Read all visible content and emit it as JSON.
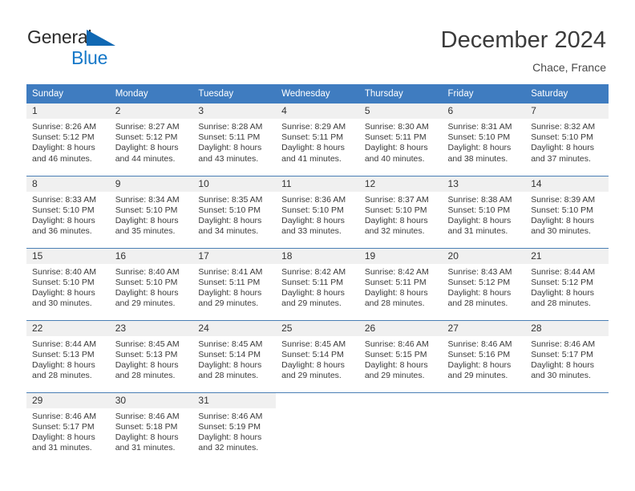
{
  "brand": {
    "name_primary": "General",
    "name_secondary": "Blue",
    "triangle_color": "#1068b3"
  },
  "header": {
    "title": "December 2024",
    "subtitle": "Chace, France",
    "accent_color": "#3f7cc0"
  },
  "weekday_headers": [
    "Sunday",
    "Monday",
    "Tuesday",
    "Wednesday",
    "Thursday",
    "Friday",
    "Saturday"
  ],
  "labels": {
    "sunrise_prefix": "Sunrise:",
    "sunset_prefix": "Sunset:",
    "daylight_prefix": "Daylight:"
  },
  "weeks": [
    [
      {
        "day": "1",
        "sunrise": "Sunrise: 8:26 AM",
        "sunset": "Sunset: 5:12 PM",
        "daylight_line1": "Daylight: 8 hours",
        "daylight_line2": "and 46 minutes."
      },
      {
        "day": "2",
        "sunrise": "Sunrise: 8:27 AM",
        "sunset": "Sunset: 5:12 PM",
        "daylight_line1": "Daylight: 8 hours",
        "daylight_line2": "and 44 minutes."
      },
      {
        "day": "3",
        "sunrise": "Sunrise: 8:28 AM",
        "sunset": "Sunset: 5:11 PM",
        "daylight_line1": "Daylight: 8 hours",
        "daylight_line2": "and 43 minutes."
      },
      {
        "day": "4",
        "sunrise": "Sunrise: 8:29 AM",
        "sunset": "Sunset: 5:11 PM",
        "daylight_line1": "Daylight: 8 hours",
        "daylight_line2": "and 41 minutes."
      },
      {
        "day": "5",
        "sunrise": "Sunrise: 8:30 AM",
        "sunset": "Sunset: 5:11 PM",
        "daylight_line1": "Daylight: 8 hours",
        "daylight_line2": "and 40 minutes."
      },
      {
        "day": "6",
        "sunrise": "Sunrise: 8:31 AM",
        "sunset": "Sunset: 5:10 PM",
        "daylight_line1": "Daylight: 8 hours",
        "daylight_line2": "and 38 minutes."
      },
      {
        "day": "7",
        "sunrise": "Sunrise: 8:32 AM",
        "sunset": "Sunset: 5:10 PM",
        "daylight_line1": "Daylight: 8 hours",
        "daylight_line2": "and 37 minutes."
      }
    ],
    [
      {
        "day": "8",
        "sunrise": "Sunrise: 8:33 AM",
        "sunset": "Sunset: 5:10 PM",
        "daylight_line1": "Daylight: 8 hours",
        "daylight_line2": "and 36 minutes."
      },
      {
        "day": "9",
        "sunrise": "Sunrise: 8:34 AM",
        "sunset": "Sunset: 5:10 PM",
        "daylight_line1": "Daylight: 8 hours",
        "daylight_line2": "and 35 minutes."
      },
      {
        "day": "10",
        "sunrise": "Sunrise: 8:35 AM",
        "sunset": "Sunset: 5:10 PM",
        "daylight_line1": "Daylight: 8 hours",
        "daylight_line2": "and 34 minutes."
      },
      {
        "day": "11",
        "sunrise": "Sunrise: 8:36 AM",
        "sunset": "Sunset: 5:10 PM",
        "daylight_line1": "Daylight: 8 hours",
        "daylight_line2": "and 33 minutes."
      },
      {
        "day": "12",
        "sunrise": "Sunrise: 8:37 AM",
        "sunset": "Sunset: 5:10 PM",
        "daylight_line1": "Daylight: 8 hours",
        "daylight_line2": "and 32 minutes."
      },
      {
        "day": "13",
        "sunrise": "Sunrise: 8:38 AM",
        "sunset": "Sunset: 5:10 PM",
        "daylight_line1": "Daylight: 8 hours",
        "daylight_line2": "and 31 minutes."
      },
      {
        "day": "14",
        "sunrise": "Sunrise: 8:39 AM",
        "sunset": "Sunset: 5:10 PM",
        "daylight_line1": "Daylight: 8 hours",
        "daylight_line2": "and 30 minutes."
      }
    ],
    [
      {
        "day": "15",
        "sunrise": "Sunrise: 8:40 AM",
        "sunset": "Sunset: 5:10 PM",
        "daylight_line1": "Daylight: 8 hours",
        "daylight_line2": "and 30 minutes."
      },
      {
        "day": "16",
        "sunrise": "Sunrise: 8:40 AM",
        "sunset": "Sunset: 5:10 PM",
        "daylight_line1": "Daylight: 8 hours",
        "daylight_line2": "and 29 minutes."
      },
      {
        "day": "17",
        "sunrise": "Sunrise: 8:41 AM",
        "sunset": "Sunset: 5:11 PM",
        "daylight_line1": "Daylight: 8 hours",
        "daylight_line2": "and 29 minutes."
      },
      {
        "day": "18",
        "sunrise": "Sunrise: 8:42 AM",
        "sunset": "Sunset: 5:11 PM",
        "daylight_line1": "Daylight: 8 hours",
        "daylight_line2": "and 29 minutes."
      },
      {
        "day": "19",
        "sunrise": "Sunrise: 8:42 AM",
        "sunset": "Sunset: 5:11 PM",
        "daylight_line1": "Daylight: 8 hours",
        "daylight_line2": "and 28 minutes."
      },
      {
        "day": "20",
        "sunrise": "Sunrise: 8:43 AM",
        "sunset": "Sunset: 5:12 PM",
        "daylight_line1": "Daylight: 8 hours",
        "daylight_line2": "and 28 minutes."
      },
      {
        "day": "21",
        "sunrise": "Sunrise: 8:44 AM",
        "sunset": "Sunset: 5:12 PM",
        "daylight_line1": "Daylight: 8 hours",
        "daylight_line2": "and 28 minutes."
      }
    ],
    [
      {
        "day": "22",
        "sunrise": "Sunrise: 8:44 AM",
        "sunset": "Sunset: 5:13 PM",
        "daylight_line1": "Daylight: 8 hours",
        "daylight_line2": "and 28 minutes."
      },
      {
        "day": "23",
        "sunrise": "Sunrise: 8:45 AM",
        "sunset": "Sunset: 5:13 PM",
        "daylight_line1": "Daylight: 8 hours",
        "daylight_line2": "and 28 minutes."
      },
      {
        "day": "24",
        "sunrise": "Sunrise: 8:45 AM",
        "sunset": "Sunset: 5:14 PM",
        "daylight_line1": "Daylight: 8 hours",
        "daylight_line2": "and 28 minutes."
      },
      {
        "day": "25",
        "sunrise": "Sunrise: 8:45 AM",
        "sunset": "Sunset: 5:14 PM",
        "daylight_line1": "Daylight: 8 hours",
        "daylight_line2": "and 29 minutes."
      },
      {
        "day": "26",
        "sunrise": "Sunrise: 8:46 AM",
        "sunset": "Sunset: 5:15 PM",
        "daylight_line1": "Daylight: 8 hours",
        "daylight_line2": "and 29 minutes."
      },
      {
        "day": "27",
        "sunrise": "Sunrise: 8:46 AM",
        "sunset": "Sunset: 5:16 PM",
        "daylight_line1": "Daylight: 8 hours",
        "daylight_line2": "and 29 minutes."
      },
      {
        "day": "28",
        "sunrise": "Sunrise: 8:46 AM",
        "sunset": "Sunset: 5:17 PM",
        "daylight_line1": "Daylight: 8 hours",
        "daylight_line2": "and 30 minutes."
      }
    ],
    [
      {
        "day": "29",
        "sunrise": "Sunrise: 8:46 AM",
        "sunset": "Sunset: 5:17 PM",
        "daylight_line1": "Daylight: 8 hours",
        "daylight_line2": "and 31 minutes."
      },
      {
        "day": "30",
        "sunrise": "Sunrise: 8:46 AM",
        "sunset": "Sunset: 5:18 PM",
        "daylight_line1": "Daylight: 8 hours",
        "daylight_line2": "and 31 minutes."
      },
      {
        "day": "31",
        "sunrise": "Sunrise: 8:46 AM",
        "sunset": "Sunset: 5:19 PM",
        "daylight_line1": "Daylight: 8 hours",
        "daylight_line2": "and 32 minutes."
      },
      {
        "day": "",
        "sunrise": "",
        "sunset": "",
        "daylight_line1": "",
        "daylight_line2": ""
      },
      {
        "day": "",
        "sunrise": "",
        "sunset": "",
        "daylight_line1": "",
        "daylight_line2": ""
      },
      {
        "day": "",
        "sunrise": "",
        "sunset": "",
        "daylight_line1": "",
        "daylight_line2": ""
      },
      {
        "day": "",
        "sunrise": "",
        "sunset": "",
        "daylight_line1": "",
        "daylight_line2": ""
      }
    ]
  ]
}
